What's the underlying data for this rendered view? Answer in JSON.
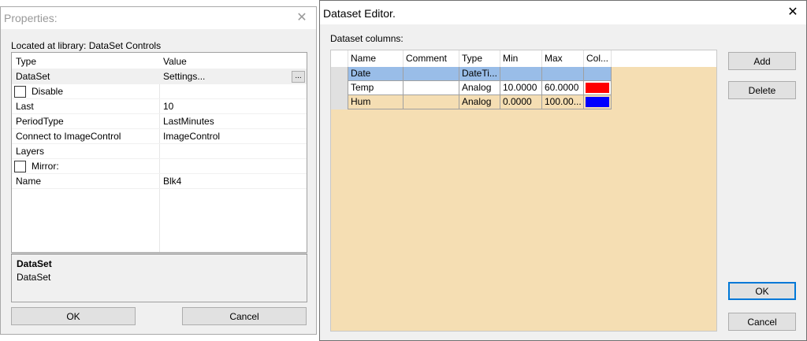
{
  "properties": {
    "title": "Properties:",
    "library_label": "Located at library: DataSet Controls",
    "header": {
      "col1": "Type",
      "col2": "Value"
    },
    "rows": [
      {
        "name": "DataSet",
        "value": "Settings...",
        "button": "..."
      },
      {
        "name": "Disable",
        "value": ""
      },
      {
        "name": "Last",
        "value": "10"
      },
      {
        "name": "PeriodType",
        "value": "LastMinutes"
      },
      {
        "name": "Connect to ImageControl",
        "value": "ImageControl"
      },
      {
        "name": "Layers",
        "value": ""
      },
      {
        "name": "Mirror:",
        "value": ""
      },
      {
        "name": "Name",
        "value": "Blk4"
      }
    ],
    "description": {
      "title": "DataSet",
      "text": "DataSet"
    },
    "ok_label": "OK",
    "cancel_label": "Cancel"
  },
  "dataset_editor": {
    "title": "Dataset Editor.",
    "columns_label": "Dataset columns:",
    "headers": [
      "Name",
      "Comment",
      "Type",
      "Min",
      "Max",
      "Col..."
    ],
    "rows": [
      {
        "name": "Date",
        "comment": "",
        "type": "DateTi...",
        "min": "",
        "max": "",
        "color": ""
      },
      {
        "name": "Temp",
        "comment": "",
        "type": "Analog",
        "min": "10.0000",
        "max": "60.0000",
        "color": "#ff0000"
      },
      {
        "name": "Hum",
        "comment": "",
        "type": "Analog",
        "min": "0.0000",
        "max": "100.00...",
        "color": "#0000ff"
      }
    ],
    "add_label": "Add",
    "delete_label": "Delete",
    "ok_label": "OK",
    "cancel_label": "Cancel"
  },
  "colors": {
    "selected_row": "#99bde8",
    "grid_background": "#f5deb3"
  },
  "icons": {
    "close": "close-icon"
  }
}
